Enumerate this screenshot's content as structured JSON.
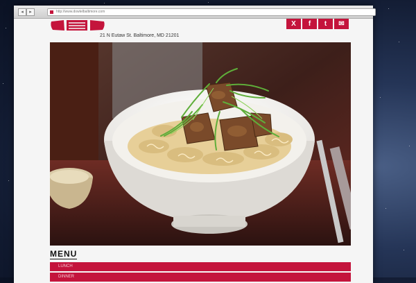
{
  "browser": {
    "url": "http://www.dowtelbaltimore.com",
    "back_label": "◂",
    "forward_label": "▸"
  },
  "header": {
    "address": "21 N Eutaw St. Baltimore, MD 21201"
  },
  "social": [
    {
      "icon": "x-icon",
      "glyph": "X"
    },
    {
      "icon": "facebook-icon",
      "glyph": "f"
    },
    {
      "icon": "twitter-icon",
      "glyph": "t"
    },
    {
      "icon": "mail-icon",
      "glyph": "✉"
    }
  ],
  "menu": {
    "title": "MENU",
    "items": [
      "LUNCH",
      "DINNER"
    ]
  },
  "colors": {
    "brand": "#c4143c",
    "background": "#f5f5f5"
  }
}
